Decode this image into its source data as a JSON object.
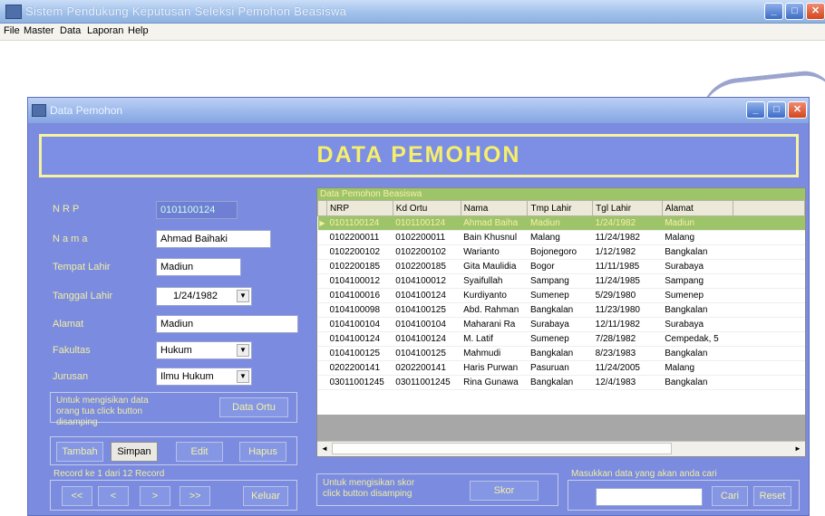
{
  "app": {
    "title": "Sistem Pendukung Keputusan Seleksi Pemohon Beasiswa",
    "menu": [
      "File",
      "Master",
      "Data",
      "Laporan",
      "Help"
    ]
  },
  "child": {
    "title": "Data Pemohon",
    "banner": "DATA PEMOHON"
  },
  "form": {
    "labels": [
      "N R P",
      "N a m a",
      "Tempat Lahir",
      "Tanggal Lahir",
      "Alamat",
      "Fakultas",
      "Jurusan"
    ],
    "nrp": "0101100124",
    "nama": "Ahmad Baihaki",
    "tempat_lahir": "Madiun",
    "tanggal_lahir": "1/24/1982",
    "alamat": "Madiun",
    "fakultas": "Hukum",
    "jurusan": "Ilmu Hukum",
    "hint_ortu": "Untuk mengisikan data orang tua click button disamping",
    "btn_ortu": "Data Ortu"
  },
  "actions": {
    "tambah": "Tambah",
    "simpan": "Simpan",
    "edit": "Edit",
    "hapus": "Hapus",
    "record_label": "Record ke 1 dari 12 Record",
    "nav": [
      "<<",
      "<",
      ">",
      ">>"
    ],
    "keluar": "Keluar"
  },
  "grid": {
    "caption": "Data Pemohon Beasiswa",
    "columns": [
      "NRP",
      "Kd Ortu",
      "Nama",
      "Tmp Lahir",
      "Tgl Lahir",
      "Alamat"
    ],
    "rows": [
      [
        "0101100124",
        "0101100124",
        "Ahmad Baiha",
        "Madiun",
        "1/24/1982",
        "Madiun"
      ],
      [
        "0102200011",
        "0102200011",
        "Bain Khusnul",
        "Malang",
        "11/24/1982",
        "Malang"
      ],
      [
        "0102200102",
        "0102200102",
        "Warianto",
        "Bojonegoro",
        "1/12/1982",
        "Bangkalan"
      ],
      [
        "0102200185",
        "0102200185",
        "Gita Maulidia",
        "Bogor",
        "11/11/1985",
        "Surabaya"
      ],
      [
        "0104100012",
        "0104100012",
        "Syaifullah",
        "Sampang",
        "11/24/1985",
        "Sampang"
      ],
      [
        "0104100016",
        "0104100124",
        "Kurdiyanto",
        "Sumenep",
        "5/29/1980",
        "Sumenep"
      ],
      [
        "0104100098",
        "0104100125",
        "Abd. Rahman",
        "Bangkalan",
        "11/23/1980",
        "Bangkalan"
      ],
      [
        "0104100104",
        "0104100104",
        "Maharani Ra",
        "Surabaya",
        "12/11/1982",
        "Surabaya"
      ],
      [
        "0104100124",
        "0104100124",
        "M. Latif",
        "Sumenep",
        "7/28/1982",
        "Cempedak, 5"
      ],
      [
        "0104100125",
        "0104100125",
        "Mahmudi",
        "Bangkalan",
        "8/23/1983",
        "Bangkalan"
      ],
      [
        "0202200141",
        "0202200141",
        "Haris Purwan",
        "Pasuruan",
        "11/24/2005",
        "Malang"
      ],
      [
        "03011001245",
        "03011001245",
        "Rina Gunawa",
        "Bangkalan",
        "12/4/1983",
        "Bangkalan"
      ]
    ]
  },
  "bottom": {
    "hint_skor": "Untuk mengisikan skor click button disamping",
    "btn_skor": "Skor",
    "search_label": "Masukkan data yang akan anda cari",
    "search_value": "",
    "btn_cari": "Cari",
    "btn_reset": "Reset"
  },
  "icons": {
    "minimize": "minimize-icon",
    "maximize": "maximize-icon",
    "close": "close-icon",
    "row_pointer": "row-pointer-icon"
  }
}
